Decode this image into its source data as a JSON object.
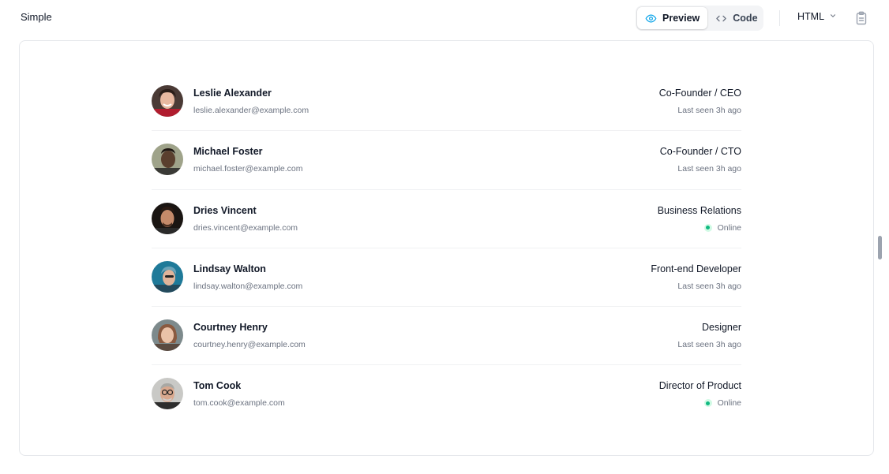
{
  "header": {
    "title": "Simple",
    "preview_label": "Preview",
    "code_label": "Code",
    "language": "HTML"
  },
  "icons": {
    "preview": "eye-icon",
    "code": "code-icon",
    "language_dropdown": "chevron-down-icon",
    "copy": "clipboard-icon",
    "online": "status-dot-icon"
  },
  "colors": {
    "online_dot": "#10b981",
    "online_ring": "#d1fae5",
    "preview_icon": "#0ea5e9"
  },
  "people": [
    {
      "name": "Leslie Alexander",
      "email": "leslie.alexander@example.com",
      "role": "Co-Founder / CEO",
      "status": "Last seen 3h ago",
      "online": false
    },
    {
      "name": "Michael Foster",
      "email": "michael.foster@example.com",
      "role": "Co-Founder / CTO",
      "status": "Last seen 3h ago",
      "online": false
    },
    {
      "name": "Dries Vincent",
      "email": "dries.vincent@example.com",
      "role": "Business Relations",
      "status": "Online",
      "online": true
    },
    {
      "name": "Lindsay Walton",
      "email": "lindsay.walton@example.com",
      "role": "Front-end Developer",
      "status": "Last seen 3h ago",
      "online": false
    },
    {
      "name": "Courtney Henry",
      "email": "courtney.henry@example.com",
      "role": "Designer",
      "status": "Last seen 3h ago",
      "online": false
    },
    {
      "name": "Tom Cook",
      "email": "tom.cook@example.com",
      "role": "Director of Product",
      "status": "Online",
      "online": true
    }
  ]
}
